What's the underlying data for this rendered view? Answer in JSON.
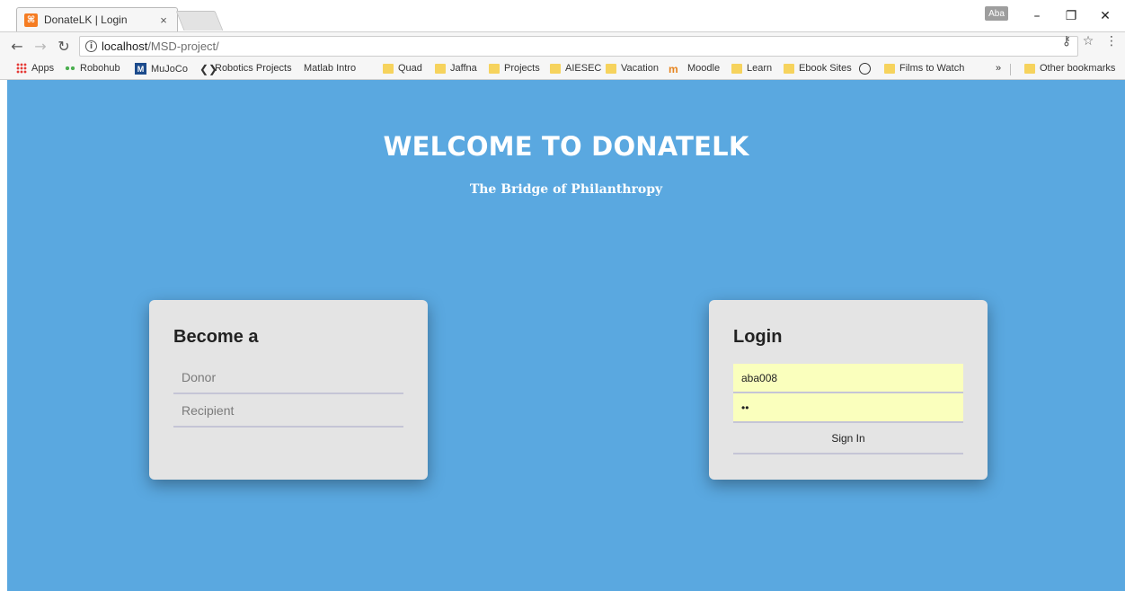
{
  "browser": {
    "tab": {
      "favicon": "xampp-icon",
      "title": "DonateLK | Login",
      "close": "×"
    },
    "profile": "Aba",
    "url": {
      "host": "localhost",
      "path": "/MSD-project/"
    },
    "bookmarks": [
      {
        "label": "Apps",
        "icon": "apps"
      },
      {
        "label": "Robohub",
        "icon": "dots"
      },
      {
        "label": "MuJoCo",
        "icon": "mj"
      },
      {
        "label": "Robotics Projects",
        "icon": "robot"
      },
      {
        "label": "Matlab Intro",
        "icon": "page"
      },
      {
        "label": "Quad",
        "icon": "folder"
      },
      {
        "label": "Jaffna",
        "icon": "folder"
      },
      {
        "label": "Projects",
        "icon": "folder"
      },
      {
        "label": "AIESEC",
        "icon": "folder"
      },
      {
        "label": "Vacation",
        "icon": "folder"
      },
      {
        "label": "Moodle",
        "icon": "moodle"
      },
      {
        "label": "Learn",
        "icon": "folder"
      },
      {
        "label": "Ebook Sites",
        "icon": "folder"
      },
      {
        "label": "",
        "icon": "circle"
      },
      {
        "label": "Films to Watch",
        "icon": "folder"
      }
    ],
    "overflow": "»",
    "other_bookmarks": "Other bookmarks"
  },
  "hero": {
    "title": "WELCOME TO DONATELK",
    "subtitle": "The Bridge of Philanthropy"
  },
  "become": {
    "heading": "Become a",
    "options": [
      "Donor",
      "Recipient"
    ]
  },
  "login": {
    "heading": "Login",
    "username": "aba008",
    "password": "••",
    "submit": "Sign In"
  },
  "colors": {
    "page_background": "#5aa8e0",
    "card_background": "#e4e4e4",
    "autofill": "#faffbd"
  }
}
